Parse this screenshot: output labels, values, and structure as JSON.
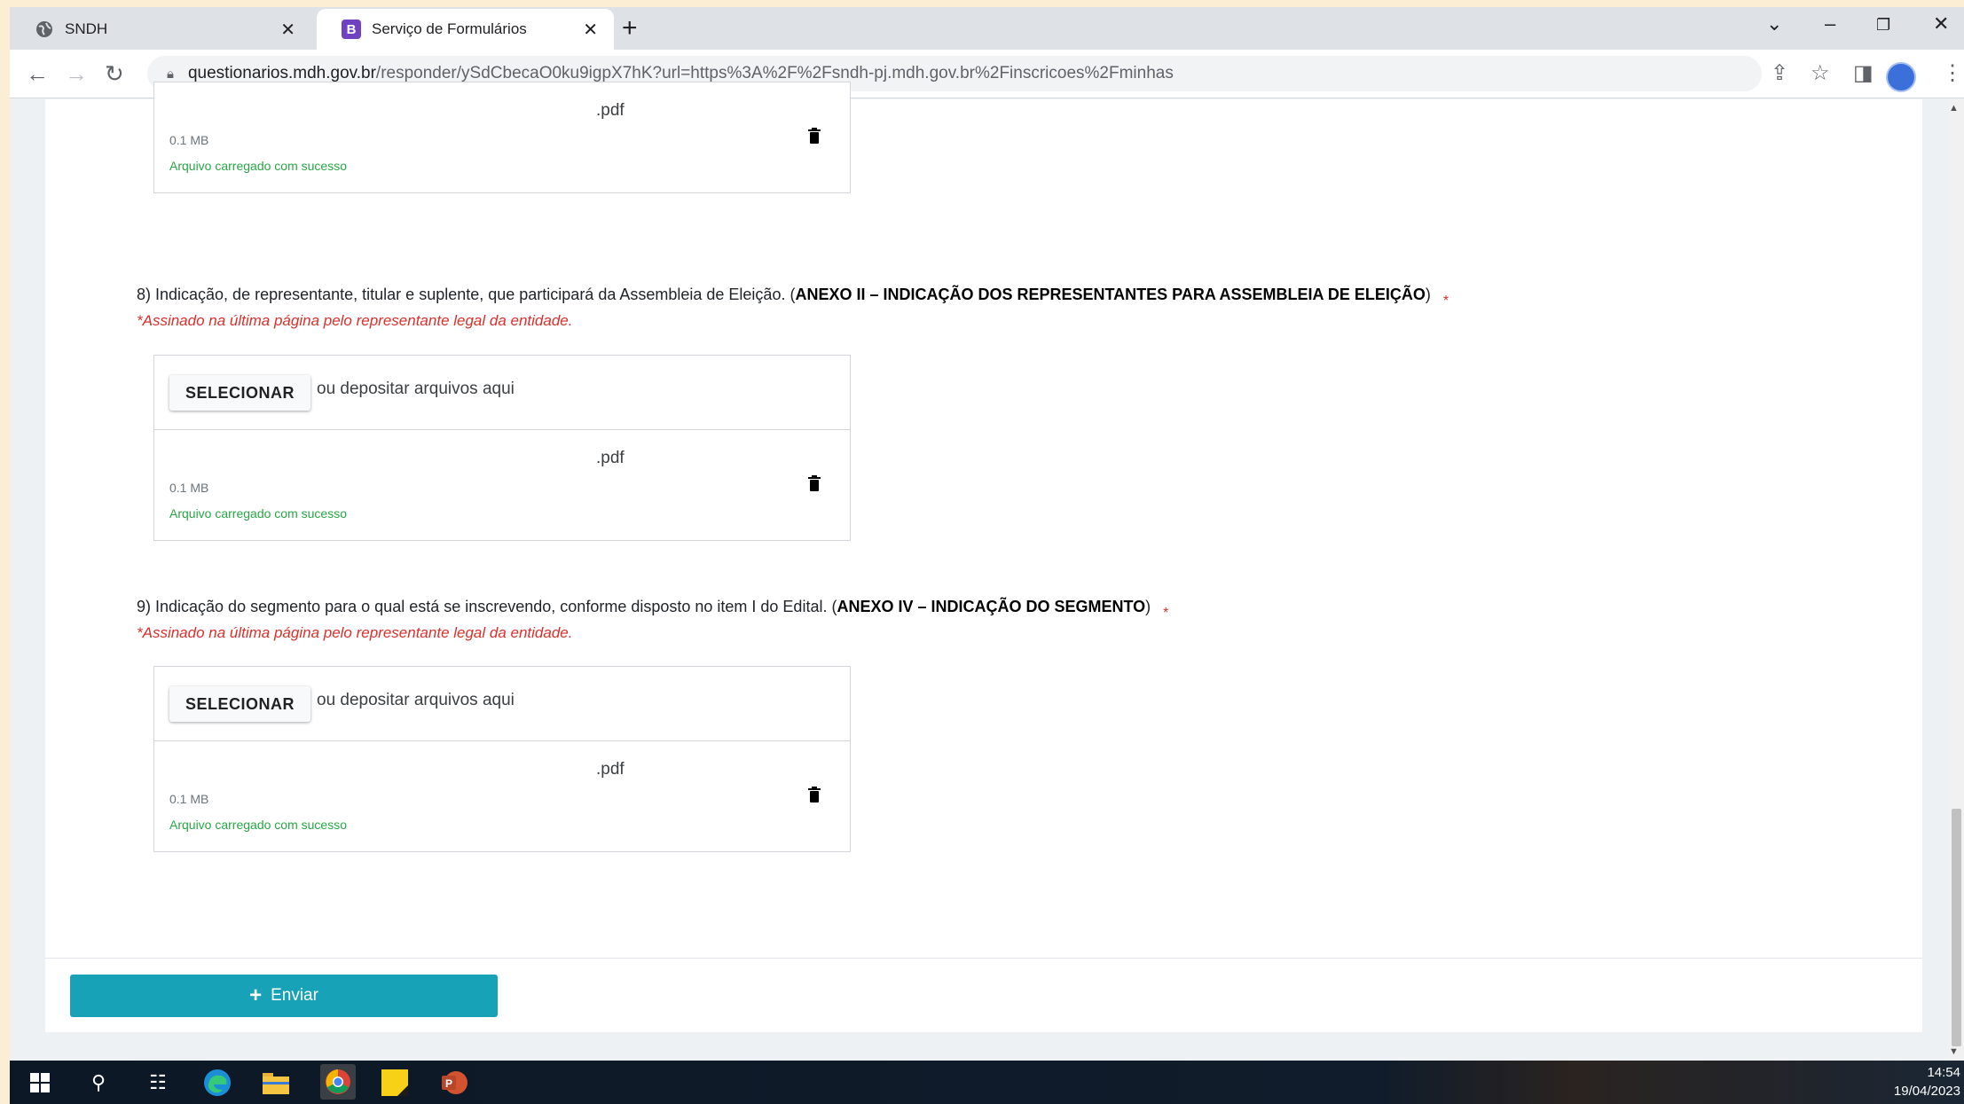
{
  "browser": {
    "tabs": [
      {
        "label": "SNDH"
      },
      {
        "label": "Serviço de Formulários",
        "favicon_letter": "B"
      }
    ],
    "url_host": "questionarios.mdh.gov.br",
    "url_path": "/responder/ySdCbecaO0ku9igpX7hK?url=https%3A%2F%2Fsndh-pj.mdh.gov.br%2Finscricoes%2Fminhas"
  },
  "form": {
    "top_upload": {
      "file_ext": ".pdf",
      "size": "0.1 MB",
      "status": "Arquivo carregado com sucesso"
    },
    "questions": [
      {
        "text": "8) Indicação, de representante, titular e suplente, que participará da Assembleia de Eleição. (",
        "bold": "ANEXO II – INDICAÇÃO DOS REPRESENTANTES PARA ASSEMBLEIA DE ELEIÇÃO",
        "close": ")",
        "required": "*",
        "note": "*Assinado na última página pelo representante legal da entidade.",
        "select_label": "SELECIONAR",
        "drop_label": "ou depositar arquivos aqui",
        "file_ext": ".pdf",
        "size": "0.1 MB",
        "status": "Arquivo carregado com sucesso"
      },
      {
        "text": "9) Indicação do segmento para o qual está se inscrevendo, conforme disposto no item I do Edital. (",
        "bold": "ANEXO IV – INDICAÇÃO DO SEGMENTO",
        "close": ")",
        "required": "*",
        "note": "*Assinado na última página pelo representante legal da entidade.",
        "select_label": "SELECIONAR",
        "drop_label": "ou depositar arquivos aqui",
        "file_ext": ".pdf",
        "size": "0.1 MB",
        "status": "Arquivo carregado com sucesso"
      }
    ],
    "submit_label": "Enviar"
  },
  "taskbar": {
    "time": "14:54",
    "date": "19/04/2023"
  },
  "colors": {
    "accent": "#17a2b8",
    "required": "#d9302c",
    "success": "#28a745"
  }
}
